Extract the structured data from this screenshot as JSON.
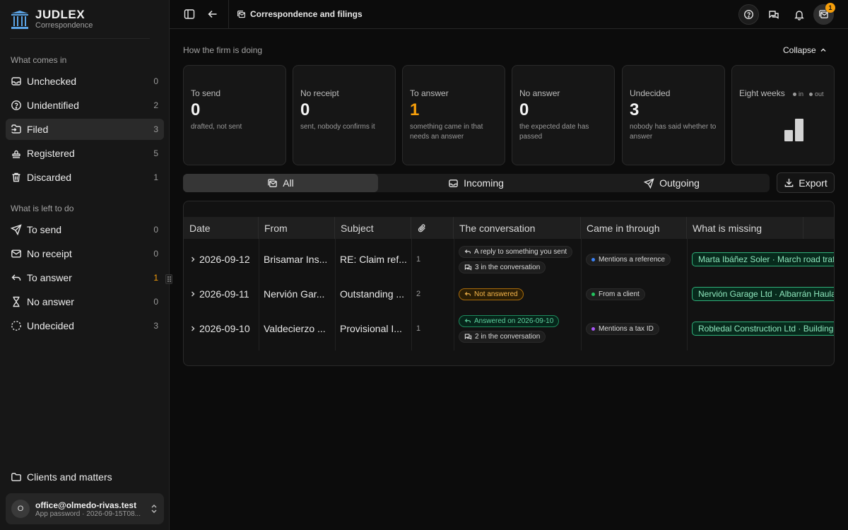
{
  "brand": {
    "title": "JUDLEX",
    "subtitle": "Correspondence"
  },
  "sidebar": {
    "section_in": "What comes in",
    "items_in": [
      {
        "label": "Unchecked",
        "count": "0",
        "icon": "inbox-icon"
      },
      {
        "label": "Unidentified",
        "count": "2",
        "icon": "help-circle-icon"
      },
      {
        "label": "Filed",
        "count": "3",
        "icon": "file-in-icon",
        "active": true
      },
      {
        "label": "Registered",
        "count": "5",
        "icon": "stamp-icon"
      },
      {
        "label": "Discarded",
        "count": "1",
        "icon": "trash-icon"
      }
    ],
    "section_todo": "What is left to do",
    "items_todo": [
      {
        "label": "To send",
        "count": "0",
        "icon": "send-icon"
      },
      {
        "label": "No receipt",
        "count": "0",
        "icon": "mail-icon"
      },
      {
        "label": "To answer",
        "count": "1",
        "icon": "reply-icon",
        "highlight": "#f59e0b"
      },
      {
        "label": "No answer",
        "count": "0",
        "icon": "hourglass-icon"
      },
      {
        "label": "Undecided",
        "count": "3",
        "icon": "dashed-circle-icon"
      }
    ],
    "bottom_link": "Clients and matters",
    "account": {
      "initial": "O",
      "email": "office@olmedo-rivas.test",
      "detail": "App password · 2026-09-15T08..."
    }
  },
  "topbar": {
    "breadcrumb": "Correspondence and filings",
    "notification_count": "1"
  },
  "overview": {
    "label": "How the firm is doing",
    "collapse_label": "Collapse",
    "cards": [
      {
        "title": "To send",
        "value": "0",
        "desc": "drafted, not sent"
      },
      {
        "title": "No receipt",
        "value": "0",
        "desc": "sent, nobody confirms it"
      },
      {
        "title": "To answer",
        "value": "1",
        "desc": "something came in that needs an answer",
        "accent": "#f59e0b"
      },
      {
        "title": "No answer",
        "value": "0",
        "desc": "the expected date has passed"
      },
      {
        "title": "Undecided",
        "value": "3",
        "desc": "nobody has said whether to answer"
      }
    ],
    "weeks_card": {
      "title": "Eight weeks",
      "legend_in": "in",
      "legend_out": "out",
      "bars": [
        {
          "series": "in",
          "value": 1
        },
        {
          "series": "out",
          "value": 2
        }
      ]
    }
  },
  "filters": {
    "tabs": [
      {
        "label": "All",
        "icon": "mail-stack-icon",
        "active": true
      },
      {
        "label": "Incoming",
        "icon": "inbox-icon"
      },
      {
        "label": "Outgoing",
        "icon": "send-icon"
      }
    ],
    "export_label": "Export"
  },
  "table": {
    "columns": [
      "Date",
      "From",
      "Subject",
      "",
      "The conversation",
      "Came in through",
      "What is missing"
    ],
    "rows": [
      {
        "date": "2026-09-12",
        "from": "Brisamar Ins...",
        "subject": "RE: Claim ref...",
        "attachments": "1",
        "conversation": [
          {
            "text": "A reply to something you sent",
            "style": "plain",
            "icon": "reply-icon"
          },
          {
            "text": "3 in the conversation",
            "style": "plain",
            "icon": "messages-icon"
          }
        ],
        "channel": {
          "text": "Mentions a reference",
          "color": "#3b82f6"
        },
        "missing": "Marta Ibáñez Soler · March road traffic"
      },
      {
        "date": "2026-09-11",
        "from": "Nervión Gar...",
        "subject": "Outstanding ...",
        "attachments": "2",
        "conversation": [
          {
            "text": "Not answered",
            "style": "amber",
            "icon": "reply-icon"
          }
        ],
        "channel": {
          "text": "From a client",
          "color": "#22c55e"
        },
        "missing": "Nervión Garage Ltd · Albarrán Haulage"
      },
      {
        "date": "2026-09-10",
        "from": "Valdecierzo ...",
        "subject": "Provisional I...",
        "attachments": "1",
        "conversation": [
          {
            "text": "Answered on 2026-09-10",
            "style": "green",
            "icon": "reply-icon"
          },
          {
            "text": "2 in the conversation",
            "style": "plain",
            "icon": "messages-icon"
          }
        ],
        "channel": {
          "text": "Mentions a tax ID",
          "color": "#a855f7"
        },
        "missing": "Robledal Construction Ltd · Building"
      }
    ]
  }
}
